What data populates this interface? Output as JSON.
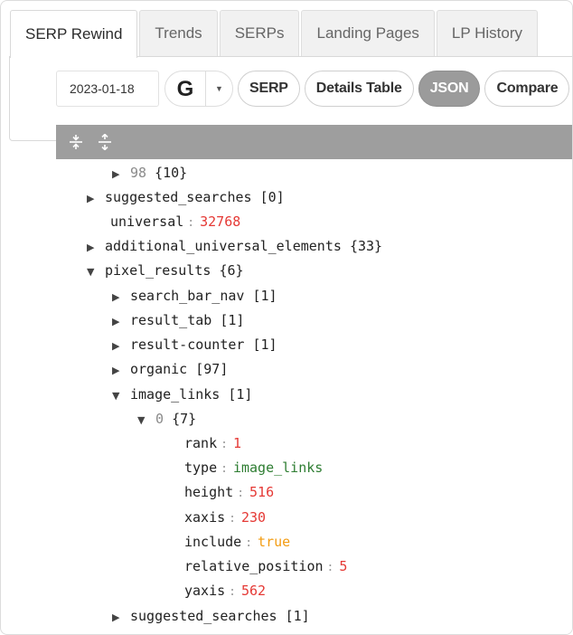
{
  "tabs": [
    "SERP Rewind",
    "Trends",
    "SERPs",
    "Landing Pages",
    "LP History"
  ],
  "toolbar": {
    "date": "2023-01-18",
    "engine_letter": "G",
    "caret": "▼",
    "buttons": [
      "SERP",
      "Details Table",
      "JSON",
      "Compare"
    ],
    "active_button": "JSON"
  },
  "viewer_icons": [
    "collapse-all-icon",
    "expand-all-icon"
  ],
  "tree": {
    "row0": {
      "arrow": "▶",
      "key": "98",
      "meta": "{10}"
    },
    "row1": {
      "arrow": "▶",
      "key": "suggested_searches",
      "meta": "[0]"
    },
    "row2": {
      "key": "universal",
      "sep": ":",
      "value": "32768"
    },
    "row3": {
      "arrow": "▶",
      "key": "additional_universal_elements",
      "meta": "{33}"
    },
    "row4": {
      "arrow": "▼",
      "key": "pixel_results",
      "meta": "{6}"
    },
    "row5": {
      "arrow": "▶",
      "key": "search_bar_nav",
      "meta": "[1]"
    },
    "row6": {
      "arrow": "▶",
      "key": "result_tab",
      "meta": "[1]"
    },
    "row7": {
      "arrow": "▶",
      "key": "result-counter",
      "meta": "[1]"
    },
    "row8": {
      "arrow": "▶",
      "key": "organic",
      "meta": "[97]"
    },
    "row9": {
      "arrow": "▼",
      "key": "image_links",
      "meta": "[1]"
    },
    "row10": {
      "arrow": "▼",
      "key": "0",
      "meta": "{7}"
    },
    "row11": {
      "key": "rank",
      "sep": ":",
      "value": "1"
    },
    "row12": {
      "key": "type",
      "sep": ":",
      "value": "image_links"
    },
    "row13": {
      "key": "height",
      "sep": ":",
      "value": "516"
    },
    "row14": {
      "key": "xaxis",
      "sep": ":",
      "value": "230"
    },
    "row15": {
      "key": "include",
      "sep": ":",
      "value": "true"
    },
    "row16": {
      "key": "relative_position",
      "sep": ":",
      "value": "5"
    },
    "row17": {
      "key": "yaxis",
      "sep": ":",
      "value": "562"
    },
    "row18": {
      "arrow": "▶",
      "key": "suggested_searches",
      "meta": "[1]"
    }
  },
  "colors": {
    "number": "#e53935",
    "string": "#2e7d32",
    "boolean": "#f39c12",
    "header": "#9e9e9e",
    "active_pill": "#9b9b9b"
  }
}
